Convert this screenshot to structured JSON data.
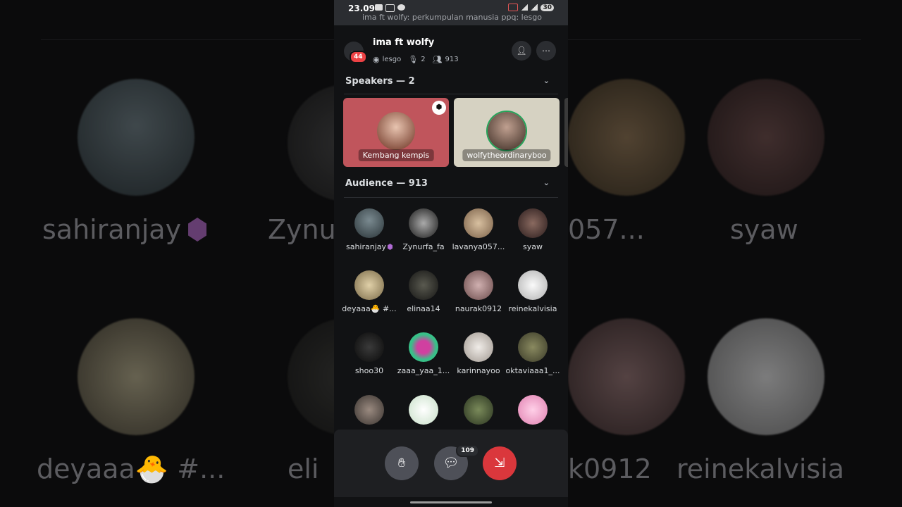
{
  "status_bar": {
    "time": "23.09",
    "ticker": "ima ft wolfy: perkumpulan manusia ppq: lesgo",
    "battery": "30"
  },
  "header": {
    "title": "ima ft wolfy",
    "badge": "44",
    "topic": "lesgo",
    "speakers_count": "2",
    "listeners_count": "913"
  },
  "speakers_section": {
    "label": "Speakers — 2",
    "items": [
      {
        "name": "Kembang kempis",
        "bg": "#c0555c"
      },
      {
        "name": "wolfytheordinaryboo",
        "bg": "#d6d2c2"
      }
    ]
  },
  "audience_section": {
    "label": "Audience — 913",
    "items": [
      {
        "name": "sahiranjay",
        "color": "#5a6a70"
      },
      {
        "name": "Zynurfa_fa",
        "color": "#3a3a3a"
      },
      {
        "name": "lavanya057...",
        "color": "#b89a7a"
      },
      {
        "name": "syaw",
        "color": "#4a3a3a"
      },
      {
        "name": "deyaaa🐣 #...",
        "color": "#c8b890"
      },
      {
        "name": "elinaa14",
        "color": "#3a3a36"
      },
      {
        "name": "naurak0912",
        "color": "#b09090"
      },
      {
        "name": "reinekalvisia",
        "color": "#e8e8e8"
      },
      {
        "name": "shoo30",
        "color": "#1a1a1a"
      },
      {
        "name": "zaaa_yaa_1...",
        "color": "#38c088"
      },
      {
        "name": "karinnayoo",
        "color": "#d8d0c8"
      },
      {
        "name": "oktaviaaa1_...",
        "color": "#5a5a40"
      },
      {
        "name": "",
        "color": "#6a6a6a"
      },
      {
        "name": "",
        "color": "#e8f0e8"
      },
      {
        "name": "",
        "color": "#4a5a3a"
      },
      {
        "name": "",
        "color": "#e8a8c8"
      }
    ]
  },
  "controls": {
    "chat_count": "109"
  },
  "background_names": {
    "a": "sahiranjay",
    "b": "Zynu",
    "c": "057...",
    "d": "syaw",
    "e": "deyaaa🐣 #...",
    "f": "eli",
    "g": "k0912",
    "h": "reinekalvisia"
  },
  "colors": {
    "accent_red": "#da373c",
    "surface": "#111214",
    "bar": "#1e1f22"
  }
}
